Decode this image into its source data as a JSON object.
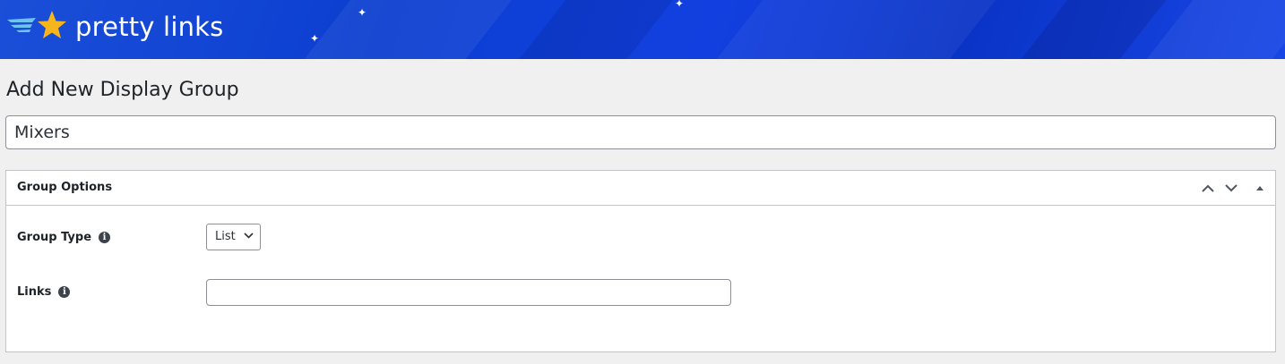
{
  "brand": {
    "name": "pretty links",
    "colors": {
      "banner": "#0b3ed0",
      "star": "#f6b61b",
      "wing": "#6fc3f0"
    }
  },
  "page": {
    "title": "Add New Display Group",
    "name_input_value": "Mixers"
  },
  "group_options": {
    "title": "Group Options",
    "controls": [
      "move-up-icon",
      "move-down-icon",
      "toggle-panel-icon"
    ],
    "group_type": {
      "label": "Group Type",
      "selected": "List"
    },
    "links": {
      "label": "Links",
      "value": ""
    }
  }
}
